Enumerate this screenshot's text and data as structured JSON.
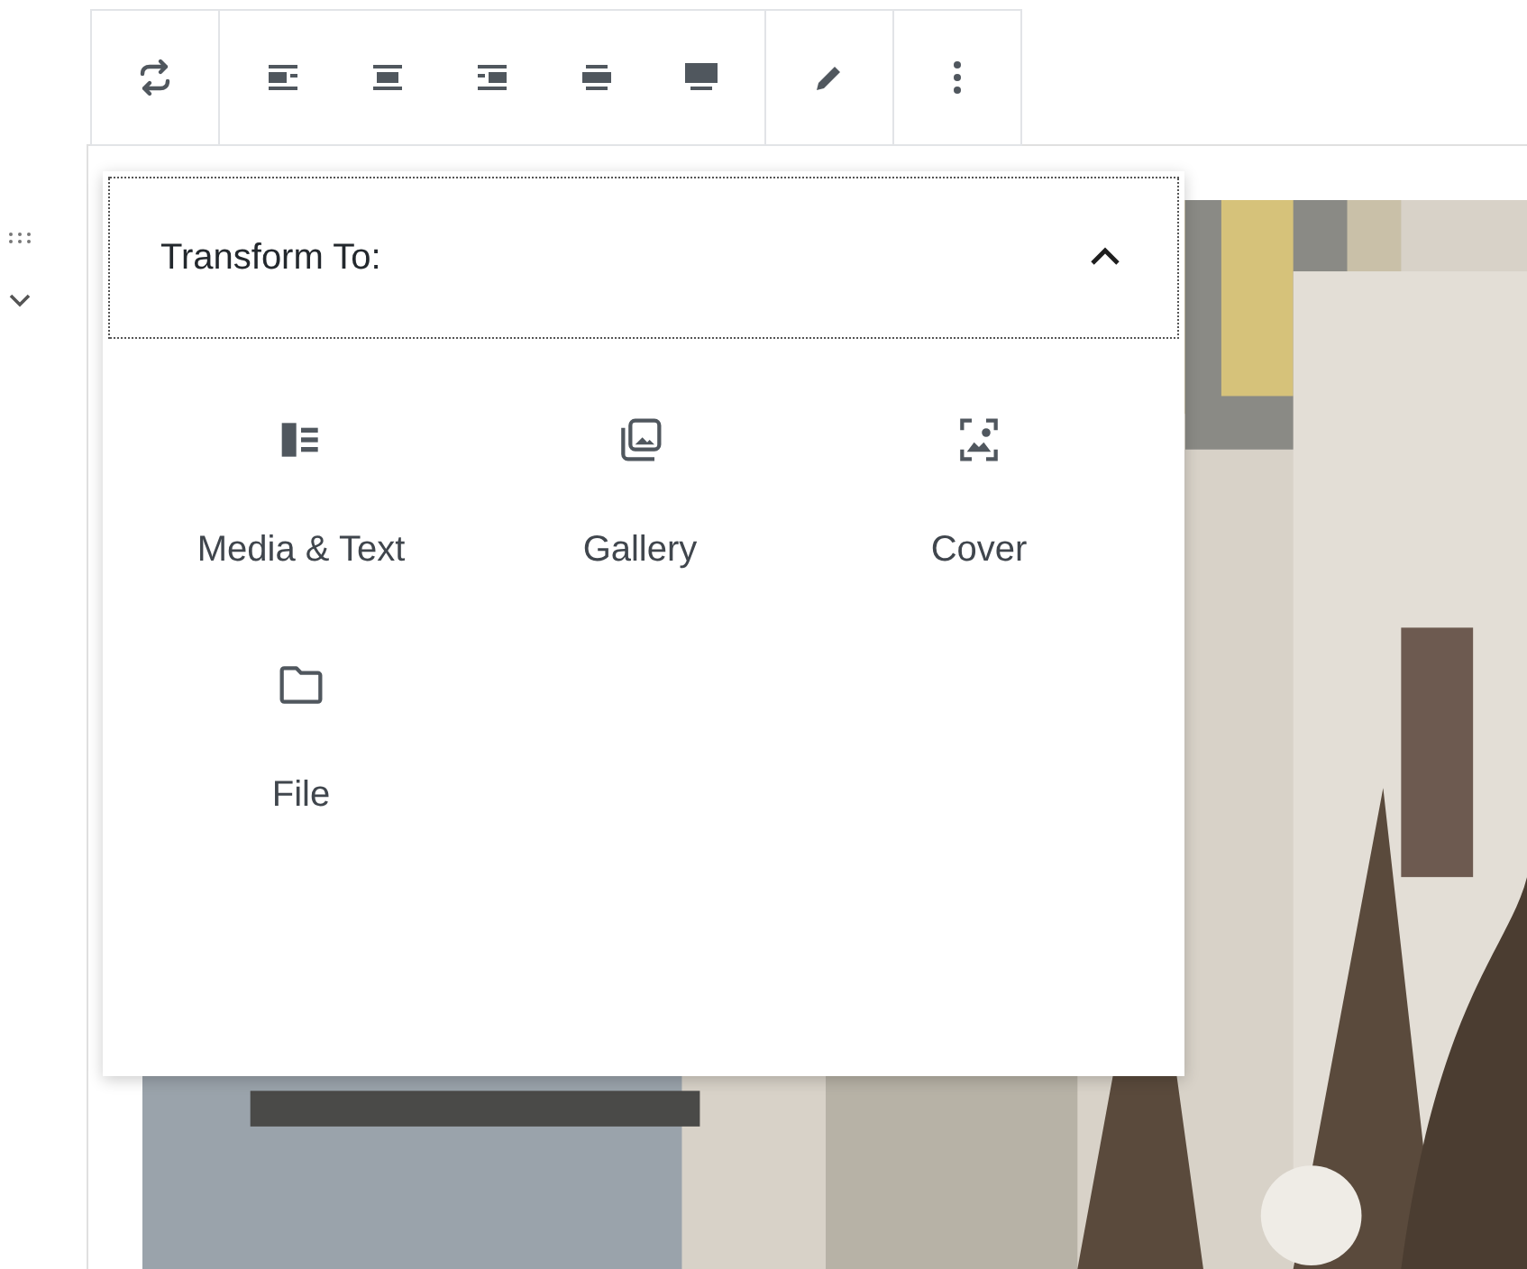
{
  "toolbar": {
    "groups": [
      {
        "buttons": [
          {
            "kind": "transform"
          }
        ]
      },
      {
        "buttons": [
          {
            "kind": "align-left"
          },
          {
            "kind": "align-center"
          },
          {
            "kind": "align-right"
          },
          {
            "kind": "align-wide"
          },
          {
            "kind": "align-full"
          }
        ]
      },
      {
        "buttons": [
          {
            "kind": "edit"
          }
        ]
      },
      {
        "buttons": [
          {
            "kind": "more"
          }
        ]
      }
    ]
  },
  "popover": {
    "title": "Transform To:",
    "expanded": true,
    "items": [
      {
        "kind": "media-text",
        "label": "Media & Text"
      },
      {
        "kind": "gallery",
        "label": "Gallery"
      },
      {
        "kind": "cover",
        "label": "Cover"
      },
      {
        "kind": "file",
        "label": "File"
      }
    ]
  }
}
